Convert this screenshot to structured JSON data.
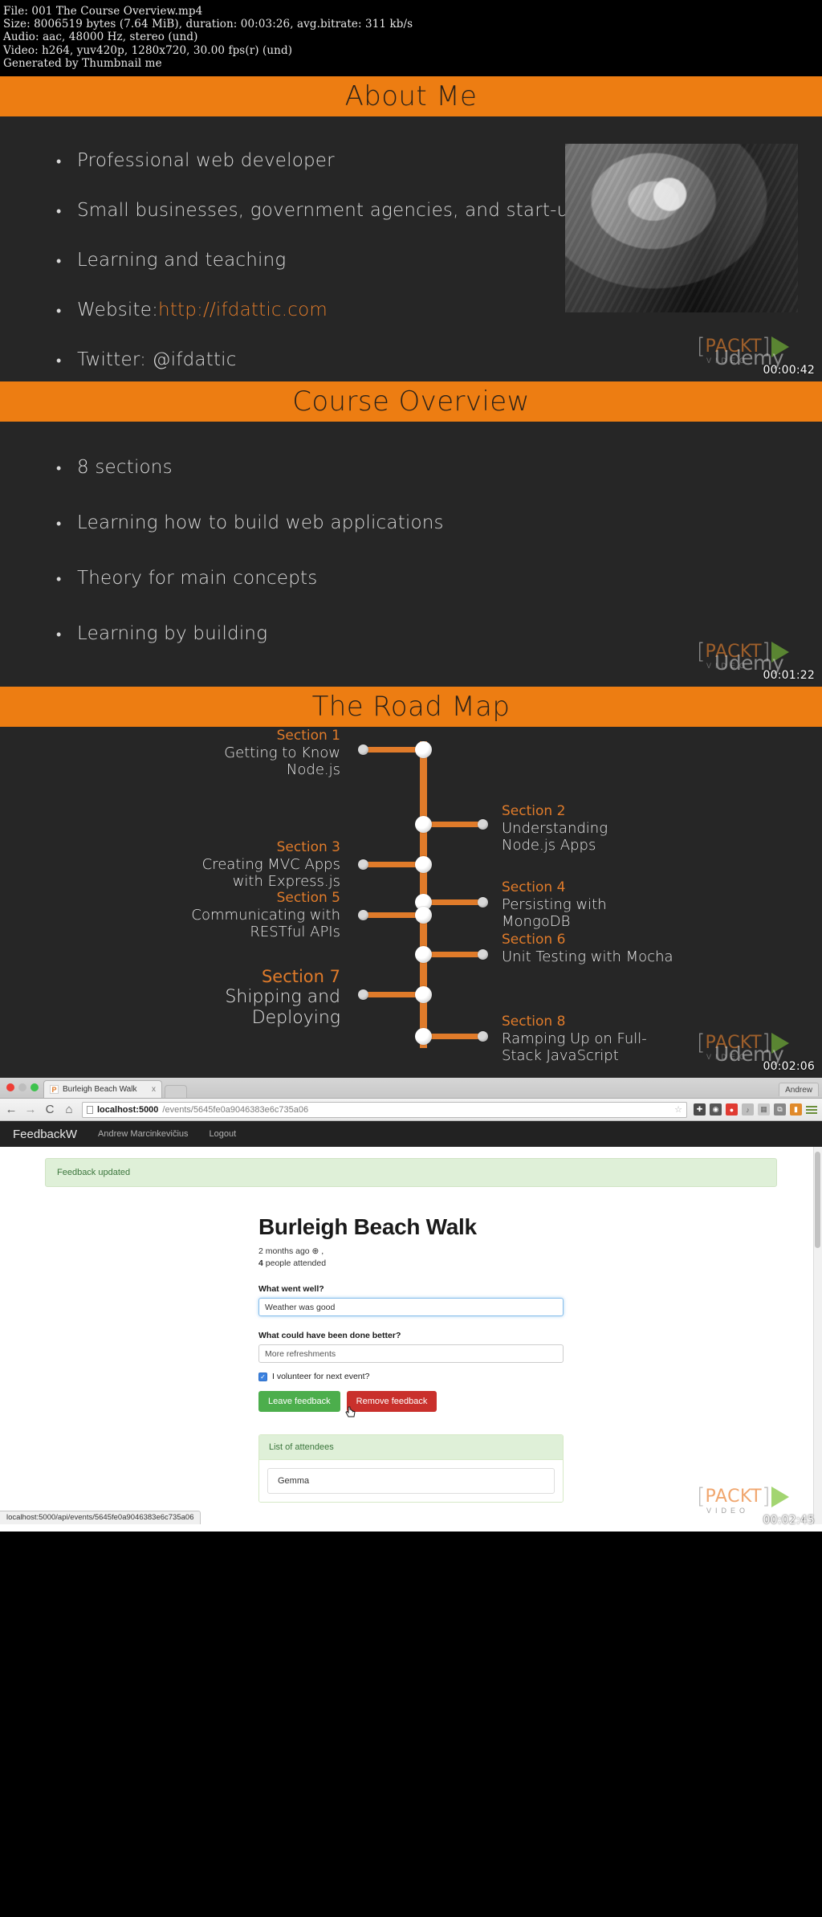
{
  "file_info": {
    "line1": "File: 001 The Course Overview.mp4",
    "line2": "Size: 8006519 bytes (7.64 MiB), duration: 00:03:26, avg.bitrate: 311 kb/s",
    "line3": "Audio: aac, 48000 Hz, stereo (und)",
    "line4": "Video: h264, yuv420p, 1280x720, 30.00 fps(r) (und)",
    "line5": "Generated by Thumbnail me"
  },
  "watermark": {
    "bracket_open": "[",
    "bracket_close": "]",
    "brand": "PACKT",
    "sub": "VIDEO",
    "overlay": "Udemy"
  },
  "slides": [
    {
      "title": "About Me",
      "timestamp": "00:00:42",
      "bullets": [
        {
          "text": "Professional web developer"
        },
        {
          "text": "Small businesses, government agencies, and start-ups"
        },
        {
          "text": "Learning and teaching"
        },
        {
          "prefix": "Website: ",
          "link": "http://ifdattic.com"
        },
        {
          "text": "Twitter: @ifdattic"
        }
      ]
    },
    {
      "title": "Course Overview",
      "timestamp": "00:01:22",
      "bullets": [
        {
          "text": "8 sections"
        },
        {
          "text": "Learning how to build web applications"
        },
        {
          "text": "Theory for main concepts"
        },
        {
          "text": "Learning by building"
        }
      ]
    },
    {
      "title": "The Road Map",
      "timestamp": "00:02:06",
      "sections": [
        {
          "label": "Section 1",
          "text": "Getting to Know\nNode.js",
          "side": "left"
        },
        {
          "label": "Section 2",
          "text": "Understanding\nNode.js Apps",
          "side": "right"
        },
        {
          "label": "Section 3",
          "text": "Creating MVC Apps\nwith Express.js",
          "side": "left"
        },
        {
          "label": "Section 4",
          "text": "Persisting with\nMongoDB",
          "side": "right"
        },
        {
          "label": "Section 5",
          "text": "Communicating with\nRESTful APIs",
          "side": "left"
        },
        {
          "label": "Section 6",
          "text": "Unit Testing with Mocha",
          "side": "right"
        },
        {
          "label": "Section 7",
          "text": "Shipping and\nDeploying",
          "side": "left"
        },
        {
          "label": "Section 8",
          "text": "Ramping Up on Full-\nStack JavaScript",
          "side": "right"
        }
      ]
    }
  ],
  "browser": {
    "timestamp": "00:02:45",
    "profile": "Andrew",
    "tab": {
      "title": "Burleigh Beach Walk",
      "favicon_letter": "P",
      "close": "x"
    },
    "nav": {
      "back": "←",
      "forward": "→",
      "reload": "C",
      "home": "⌂"
    },
    "omnibox": {
      "url_host": "localhost:5000",
      "url_path": "/events/5645fe0a9046383e6c735a06",
      "star": "☆"
    },
    "extensions": [
      "shield-icon",
      "clock-icon",
      "record-icon",
      "mute-icon",
      "grid-icon",
      "clip-icon",
      "battery-icon"
    ],
    "status_bar": "localhost:5000/api/events/5645fe0a9046383e6c735a06"
  },
  "app": {
    "brand": "FeedbackW",
    "user": "Andrew Marcinkevičius",
    "logout": "Logout",
    "flash": "Feedback updated",
    "event": {
      "title": "Burleigh Beach Walk",
      "meta_time": "2 months ago ⊕ ,",
      "meta_attended_count": "4",
      "meta_attended_text": " people attended"
    },
    "form": {
      "label_well": "What went well?",
      "value_well": "Weather was good",
      "label_better": "What could have been done better?",
      "value_better": "More refreshments",
      "checkbox_label": "I volunteer for next event?",
      "checkbox_mark": "✓",
      "btn_leave": "Leave feedback",
      "btn_remove": "Remove feedback"
    },
    "attendees": {
      "panel_title": "List of attendees",
      "items": [
        "Gemma"
      ]
    }
  },
  "colors": {
    "accent_orange": "#ed7d12",
    "slide_bg": "#262626",
    "success_green": "#4cae4c",
    "danger_red": "#c9302c"
  }
}
